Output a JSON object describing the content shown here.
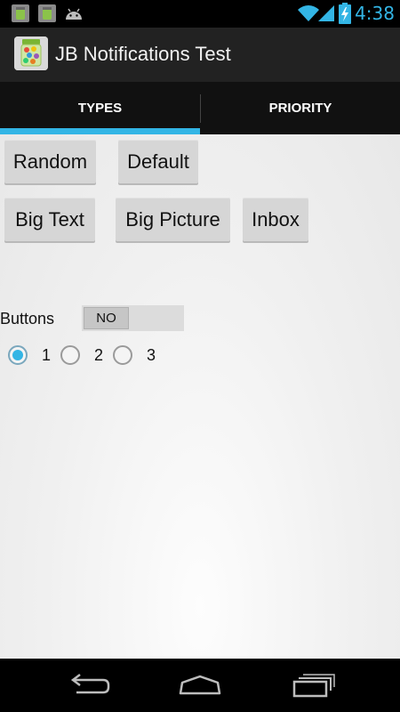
{
  "status_bar": {
    "time": "4:38",
    "left_icons": [
      "app-notification-icon",
      "app-notification-icon",
      "android-icon"
    ],
    "right_icons": [
      "wifi-icon",
      "signal-icon",
      "battery-charging-icon"
    ],
    "accent": "#33b5e5"
  },
  "action_bar": {
    "title": "JB Notifications Test",
    "icon": "app-icon"
  },
  "tabs": [
    {
      "label": "TYPES",
      "selected": true
    },
    {
      "label": "PRIORITY",
      "selected": false
    }
  ],
  "buttons": {
    "random": "Random",
    "default": "Default",
    "big_text": "Big Text",
    "big_picture": "Big Picture",
    "inbox": "Inbox"
  },
  "buttons_option": {
    "label": "Buttons",
    "toggle_value": "NO"
  },
  "radio_options": [
    {
      "label": "1",
      "checked": true
    },
    {
      "label": "2",
      "checked": false
    },
    {
      "label": "3",
      "checked": false
    }
  ],
  "nav_bar": {
    "icons": [
      "back-icon",
      "home-icon",
      "recent-apps-icon"
    ]
  }
}
